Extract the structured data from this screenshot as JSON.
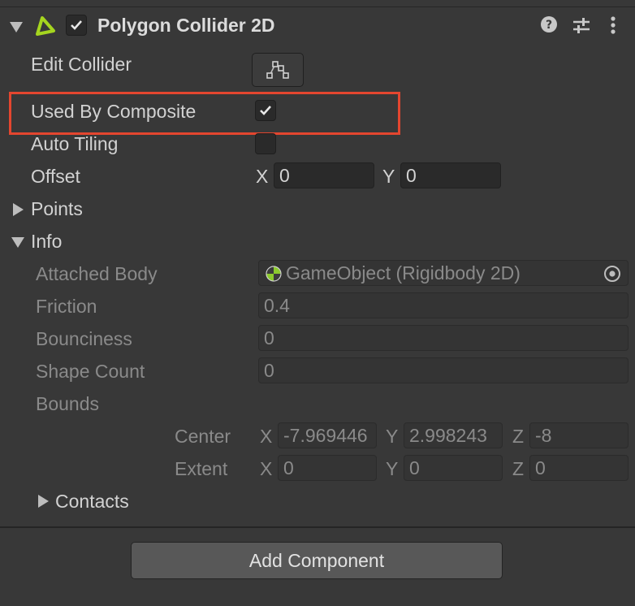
{
  "component": {
    "title": "Polygon Collider 2D",
    "enabled": true,
    "icons": [
      "polygon-collider-icon",
      "help-icon",
      "preset-sliders-icon",
      "kebab-menu-icon"
    ]
  },
  "fields": {
    "edit_collider": {
      "label": "Edit Collider",
      "icon": "edit-shape-icon"
    },
    "used_by_composite": {
      "label": "Used By Composite",
      "checked": true
    },
    "auto_tiling": {
      "label": "Auto Tiling",
      "checked": false
    },
    "offset": {
      "label": "Offset",
      "x_label": "X",
      "x": "0",
      "y_label": "Y",
      "y": "0"
    },
    "points": {
      "label": "Points",
      "expanded": false
    }
  },
  "info": {
    "label": "Info",
    "expanded": true,
    "attached_body": {
      "label": "Attached Body",
      "value": "GameObject (Rigidbody 2D)",
      "icon": "rigidbody-object-icon"
    },
    "friction": {
      "label": "Friction",
      "value": "0.4"
    },
    "bounciness": {
      "label": "Bounciness",
      "value": "0"
    },
    "shape_count": {
      "label": "Shape Count",
      "value": "0"
    },
    "bounds": {
      "label": "Bounds",
      "center": {
        "label": "Center",
        "x_label": "X",
        "x": "-7.969446",
        "y_label": "Y",
        "y": "2.998243",
        "z_label": "Z",
        "z": "-8"
      },
      "extent": {
        "label": "Extent",
        "x_label": "X",
        "x": "0",
        "y_label": "Y",
        "y": "0",
        "z_label": "Z",
        "z": "0"
      }
    },
    "contacts": {
      "label": "Contacts",
      "expanded": false
    }
  },
  "footer": {
    "add_component_label": "Add Component"
  },
  "highlight": {
    "color": "#e4462f",
    "target": "used_by_composite"
  },
  "colors": {
    "accent_green": "#a5d51f",
    "background": "#383838"
  }
}
